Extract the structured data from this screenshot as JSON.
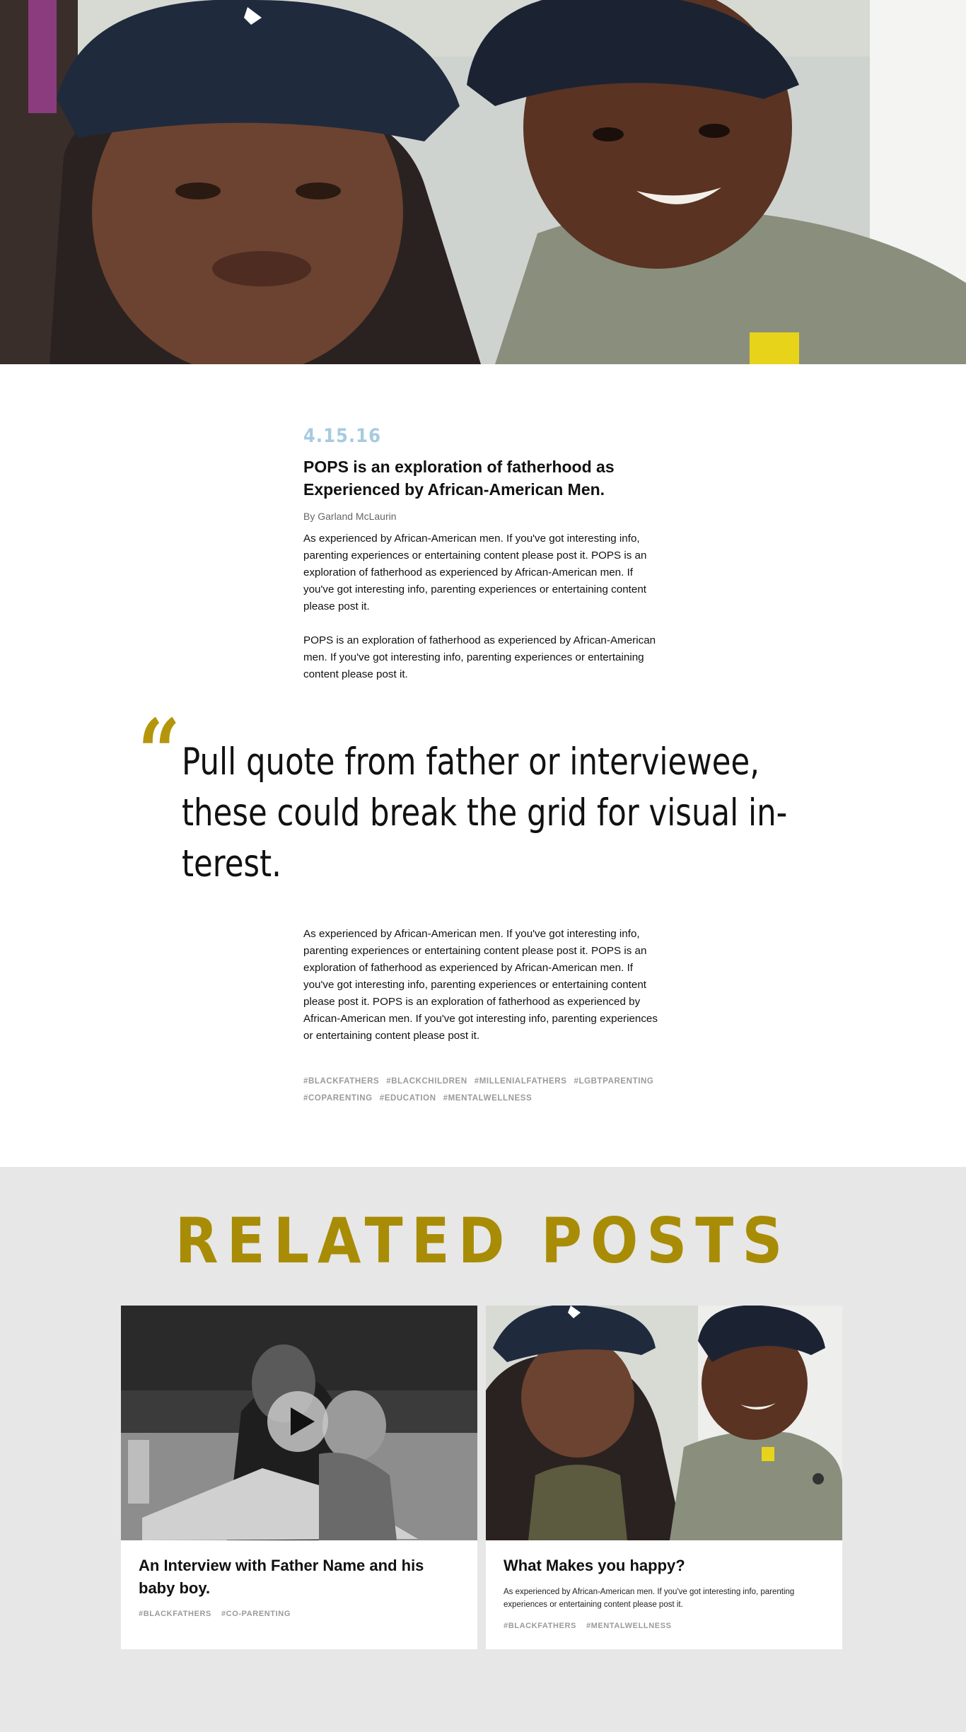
{
  "hero": {
    "image_alt": "Father and son smiling selfie"
  },
  "article": {
    "date": "4.15.16",
    "headline": "POPS is an exploration of fatherhood as Experienced by African-American Men.",
    "byline": "By Garland McLaurin",
    "paragraphs": [
      "As experienced by African-American men. If you've got interesting info, parenting experiences or entertaining content please post it. POPS is an exploration of fatherhood as experienced by African-American men. If you've got interesting info, parenting experiences or entertaining content please post it.",
      "POPS is an exploration of fatherhood as experienced by African-American men. If you've got interesting info, parenting experiences or entertaining content please post it."
    ],
    "pullquote": {
      "mark": "“",
      "lines": [
        "Pull quote from father or interviewee,",
        "these could break the grid for visual in-",
        "terest."
      ]
    },
    "paragraph_after": "As experienced by African-American men. If you've got interesting info, parenting experiences or entertaining content please post it. POPS is an exploration of fatherhood as experienced by African-American men. If you've got interesting info, parenting experiences or entertaining content please post it. POPS is an exploration of fatherhood as experienced by African-American men. If you've got interesting info, parenting experiences or entertaining content please post it.",
    "tags": [
      "#BLACKFATHERS",
      "#BLACKCHILDREN",
      "#MILLENIALFATHERS",
      "#LGBTPARENTING",
      "#COPARENTING",
      "#EDUCATION",
      "#MENTALWELLNESS"
    ]
  },
  "related": {
    "title": "RELATED POSTS",
    "cards": [
      {
        "title": "An Interview with Father Name and his baby boy.",
        "excerpt": "",
        "tags": [
          "#BLACKFATHERS",
          "#CO-PARENTING"
        ],
        "has_video": true
      },
      {
        "title": "What Makes you happy?",
        "excerpt": "As experienced by African-American men. If you've got interesting info, parenting experiences or entertaining content please post it.",
        "tags": [
          "#BLACKFATHERS",
          "#MENTALWELLNESS"
        ],
        "has_video": false
      }
    ]
  },
  "colors": {
    "accent_gold": "#a88c06",
    "date_blue": "#a7cbe0",
    "tag_gray": "#9a9a9a",
    "related_bg": "#e7e7e7"
  }
}
